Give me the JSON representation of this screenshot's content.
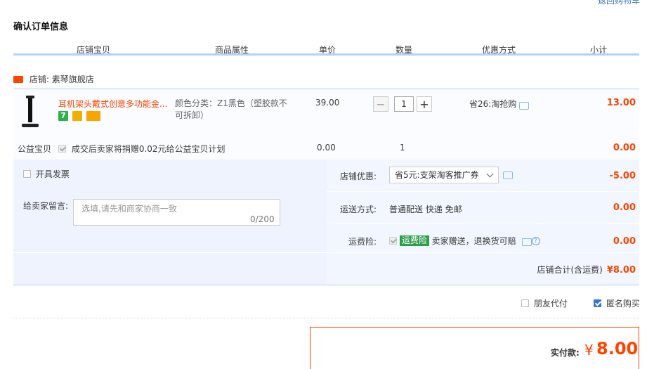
{
  "title": "确认订单信息",
  "columns": [
    "店铺宝贝",
    "商品属性",
    "单价",
    "数量",
    "优惠方式",
    "小计"
  ],
  "shop": {
    "label": "店铺:",
    "name": "素琴旗舰店"
  },
  "item": {
    "title": "耳机架头戴式创意多功能金...",
    "badge_1": "7",
    "attr_line1": "颜色分类：Z1黑色（塑胶款不",
    "attr_line2": "可拆卸）",
    "price": "39.00",
    "qty_minus": "−",
    "qty": "1",
    "qty_plus": "+",
    "promo": "省26:淘抢购",
    "subtotal": "13.00"
  },
  "charity": {
    "label": "公益宝贝",
    "text": "成交后卖家将捐赠0.02元给公益宝贝计划",
    "price": "0.00",
    "qty": "1",
    "subtotal": "0.00"
  },
  "invoice": {
    "label": "开具发票"
  },
  "message": {
    "label": "给卖家留言:",
    "placeholder": "选填,请先和商家协商一致",
    "count": "0/200"
  },
  "coupon": {
    "label": "店铺优惠:",
    "selected": "省5元:支架淘客推广券",
    "amount": "-5.00"
  },
  "shipping": {
    "label": "运送方式:",
    "text": "普通配送 快递 免邮",
    "amount": "0.00"
  },
  "insurance": {
    "label": "运费险:",
    "badge": "运费险",
    "text": "卖家赠送，退换货可赔",
    "amount": "0.00",
    "help": "?"
  },
  "shop_total": {
    "label": "店铺合计(含运费)",
    "value": "¥8.00"
  },
  "options": {
    "friend_pay": "朋友代付",
    "anonymous": "匿名购买"
  },
  "pay": {
    "label": "实付款:",
    "currency": "¥",
    "amount": "8.00"
  },
  "colors": {
    "accent": "#ff4400",
    "header_line": "#b2d1ff",
    "row_bg": "#f2f7ff",
    "checkbox": "#3377d6"
  }
}
